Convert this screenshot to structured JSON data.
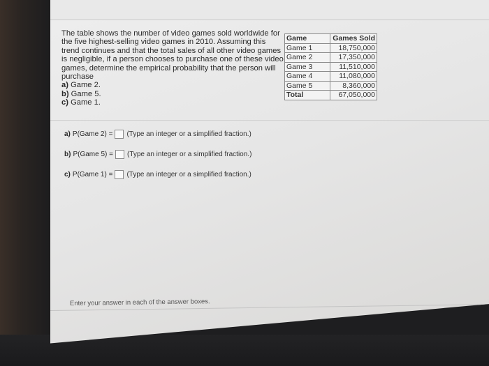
{
  "problem": {
    "text": "The table shows the number of video games sold worldwide for the five highest-selling video games in 2010. Assuming this trend continues and that the total sales of all other video games is negligible, if a person chooses to purchase one of these video games, determine the empirical probability that the person will purchase",
    "parts": [
      {
        "label": "a)",
        "text": "Game 2."
      },
      {
        "label": "b)",
        "text": "Game 5."
      },
      {
        "label": "c)",
        "text": "Game 1."
      }
    ]
  },
  "table": {
    "headers": [
      "Game",
      "Games Sold"
    ],
    "rows": [
      {
        "game": "Game 1",
        "sold": "18,750,000"
      },
      {
        "game": "Game 2",
        "sold": "17,350,000"
      },
      {
        "game": "Game 3",
        "sold": "11,510,000"
      },
      {
        "game": "Game 4",
        "sold": "11,080,000"
      },
      {
        "game": "Game 5",
        "sold": "8,360,000"
      },
      {
        "game": "Total",
        "sold": "67,050,000"
      }
    ]
  },
  "answers": [
    {
      "label": "a)",
      "expr": "P(Game 2) =",
      "value": "",
      "hint": "(Type an integer or a simplified fraction.)"
    },
    {
      "label": "b)",
      "expr": "P(Game 5) =",
      "value": "",
      "hint": "(Type an integer or a simplified fraction.)"
    },
    {
      "label": "c)",
      "expr": "P(Game 1) =",
      "value": "",
      "hint": "(Type an integer or a simplified fraction.)"
    }
  ],
  "footer": {
    "instruction": "Enter your answer in each of the answer boxes."
  }
}
